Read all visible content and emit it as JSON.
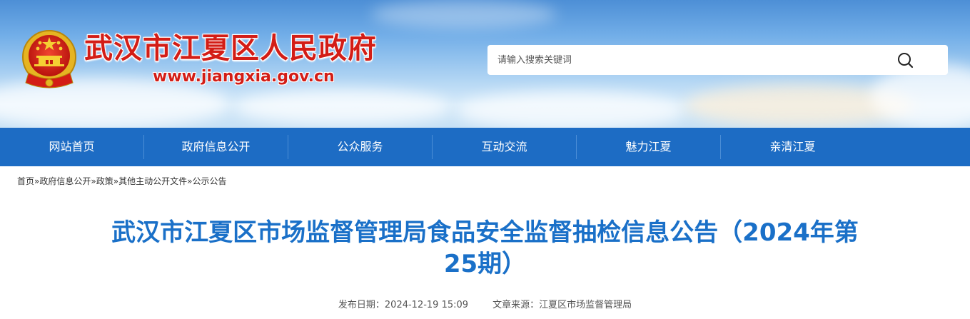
{
  "header": {
    "site_name": "武汉市江夏区人民政府",
    "site_url": "www.jiangxia.gov.cn",
    "emblem_icon": "national-emblem-icon",
    "search": {
      "placeholder": "请输入搜索关键词",
      "value": "",
      "button_icon": "search-icon"
    }
  },
  "nav": {
    "items": [
      {
        "label": "网站首页"
      },
      {
        "label": "政府信息公开"
      },
      {
        "label": "公众服务"
      },
      {
        "label": "互动交流"
      },
      {
        "label": "魅力江夏"
      },
      {
        "label": "亲清江夏"
      }
    ]
  },
  "breadcrumb": {
    "items": [
      "首页",
      "政府信息公开",
      "政策",
      "其他主动公开文件",
      "公示公告"
    ],
    "separator": "»"
  },
  "article": {
    "title_line1": "武汉市江夏区市场监督管理局食品安全监督抽检信息公告（2024年第",
    "title_line2": "25期）",
    "publish_date_label": "发布日期：",
    "publish_date": "2024-12-19 15:09",
    "source_label": "文章来源：",
    "source": "江夏区市场监督管理局"
  },
  "colors": {
    "nav_bg": "#1d6cc4",
    "title": "#1a70c8",
    "site_name": "#d31d16"
  }
}
